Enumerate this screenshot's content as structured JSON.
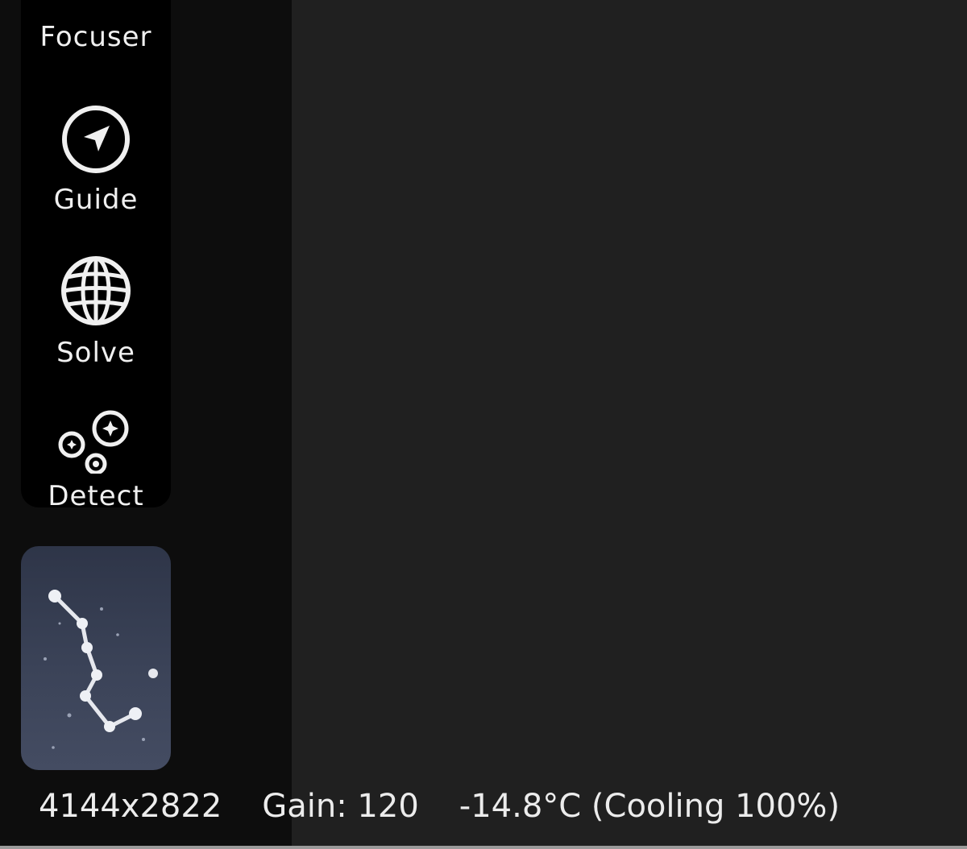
{
  "toolbar": {
    "items": [
      {
        "label": "Focuser",
        "icon": "focus-frame-icon"
      },
      {
        "label": "Guide",
        "icon": "navigation-arrow-icon"
      },
      {
        "label": "Solve",
        "icon": "globe-grid-icon"
      },
      {
        "label": "Detect",
        "icon": "star-detect-icon"
      }
    ]
  },
  "thumbnail": {
    "icon": "constellation-icon"
  },
  "status": {
    "resolution": "4144x2822",
    "gain": "Gain: 120",
    "temperature": "-14.8°C (Cooling 100%)"
  },
  "colors": {
    "preview_background": "#202020",
    "toolbar_background": "#000000",
    "thumbnail_background": "#3b4358"
  }
}
